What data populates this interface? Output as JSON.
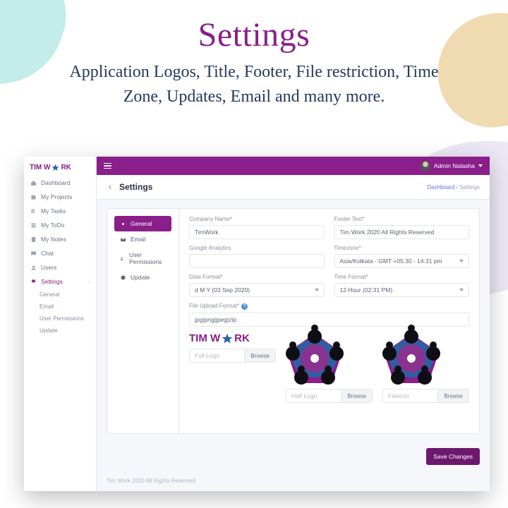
{
  "hero": {
    "title": "Settings",
    "subtitle": "Application Logos, Title, Footer, File restriction, Time Zone, Updates, Email and many more."
  },
  "brand": {
    "pre": "TIM W",
    "post": "RK"
  },
  "user": {
    "name": "Admin Natasha"
  },
  "sidebar": {
    "items": [
      {
        "label": "Dashboard"
      },
      {
        "label": "My Projects"
      },
      {
        "label": "My Tasks"
      },
      {
        "label": "My ToDo"
      },
      {
        "label": "My Notes"
      },
      {
        "label": "Chat"
      },
      {
        "label": "Users"
      },
      {
        "label": "Settings"
      }
    ],
    "sub": [
      {
        "label": "General"
      },
      {
        "label": "Email"
      },
      {
        "label": "User Permissions"
      },
      {
        "label": "Update"
      }
    ]
  },
  "page": {
    "title": "Settings",
    "breadcrumb_root": "Dashboard",
    "breadcrumb_current": "Settings"
  },
  "tabs": [
    {
      "label": "General"
    },
    {
      "label": "Email"
    },
    {
      "label": "User Permissions"
    },
    {
      "label": "Update"
    }
  ],
  "form": {
    "company_label": "Company Name*",
    "company_value": "TimWork",
    "footer_label": "Footer Text*",
    "footer_value": "Tim Work 2020 All Rights Reserved",
    "ga_label": "Google Analytics",
    "ga_value": "",
    "tz_label": "Timezone*",
    "tz_value": "Asia/Kolkata - GMT +05:30 - 14:31 pm",
    "df_label": "Date Format*",
    "df_value": "d M Y (03 Sep 2020)",
    "tf_label": "Time Format*",
    "tf_value": "12 Hour (02:31 PM)",
    "fu_label": "File Upload Format*",
    "fu_value": "jpg|png|jpeg|zip",
    "full_ph": "Full Logo",
    "half_ph": "Half Logo",
    "fav_ph": "Favicon",
    "browse": "Browse",
    "submit": "Save Changes"
  },
  "footer": {
    "text": "Tim Work 2020 All Rights Reserved"
  }
}
